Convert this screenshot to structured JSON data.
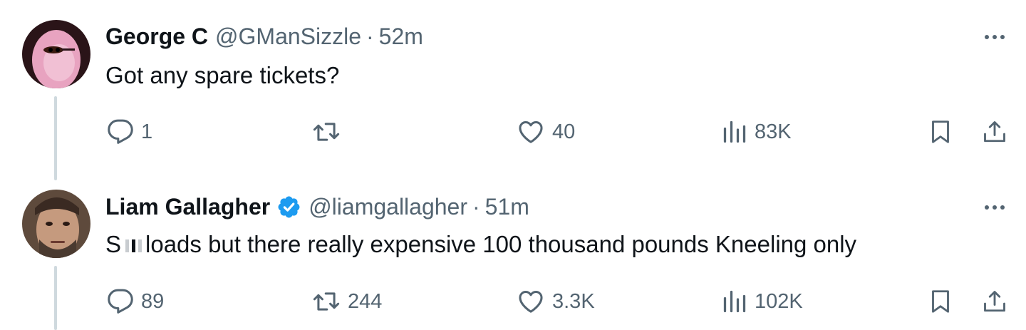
{
  "icons": {
    "reply": "reply-icon",
    "retweet": "retweet-icon",
    "like": "heart-icon",
    "views": "views-icon",
    "bookmark": "bookmark-icon",
    "share": "share-icon",
    "more": "more-icon",
    "verified": "verified-badge-icon"
  },
  "colors": {
    "text": "#0f1419",
    "secondary": "#536471",
    "verified": "#1d9bf0",
    "thread_line": "#cfd9de"
  },
  "tweets": [
    {
      "author_name": "George C",
      "handle": "@GManSizzle",
      "separator": "·",
      "time": "52m",
      "verified": false,
      "text": "Got any spare tickets?",
      "reply_count": "1",
      "retweet_count": "",
      "like_count": "40",
      "view_count": "83K"
    },
    {
      "author_name": "Liam Gallagher",
      "handle": "@liamgallagher",
      "separator": "·",
      "time": "51m",
      "verified": true,
      "text_prefix": "S",
      "text": "loads but there really expensive 100 thousand pounds Kneeling only",
      "reply_count": "89",
      "retweet_count": "244",
      "like_count": "3.3K",
      "view_count": "102K"
    }
  ]
}
